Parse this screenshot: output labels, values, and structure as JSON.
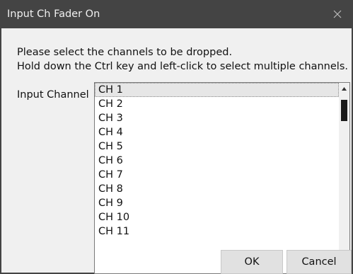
{
  "window": {
    "title": "Input Ch Fader On",
    "close_glyph": "✕"
  },
  "instructions": {
    "line1": "Please select the channels to be dropped.",
    "line2": "Hold down the Ctrl key and left-click to select multiple channels."
  },
  "channel_list": {
    "label": "Input Channel",
    "selected_index": 0,
    "items": [
      "CH 1",
      "CH 2",
      "CH 3",
      "CH 4",
      "CH 5",
      "CH 6",
      "CH 7",
      "CH 8",
      "CH 9",
      "CH 10",
      "CH 11"
    ]
  },
  "buttons": {
    "ok_label": "OK",
    "cancel_label": "Cancel"
  },
  "colors": {
    "titlebar_bg": "#444444",
    "dialog_body_bg": "#f0f0f0",
    "selected_item_bg": "#e6e6e6",
    "button_bg": "#e1e1e1"
  },
  "icons": {
    "close": "close-icon",
    "scroll_up": "scroll-up-arrow-icon",
    "scroll_down": "scroll-down-arrow-icon"
  }
}
